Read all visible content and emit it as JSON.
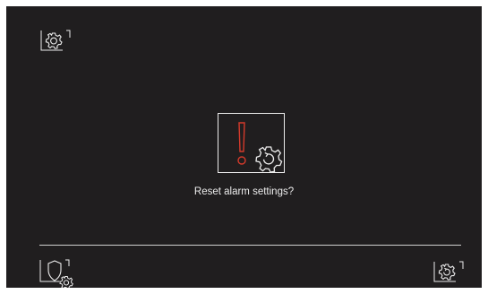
{
  "dialog": {
    "message": "Reset alarm settings?"
  },
  "icons": {
    "top_left": "settings-gear-icon",
    "center": "alarm-reset-warning-icon",
    "bottom_left": "alarm-shield-settings-icon",
    "bottom_right": "settings-gear-icon"
  },
  "colors": {
    "background": "#201e1f",
    "foreground": "#ececec",
    "warning": "#d43a2b"
  }
}
